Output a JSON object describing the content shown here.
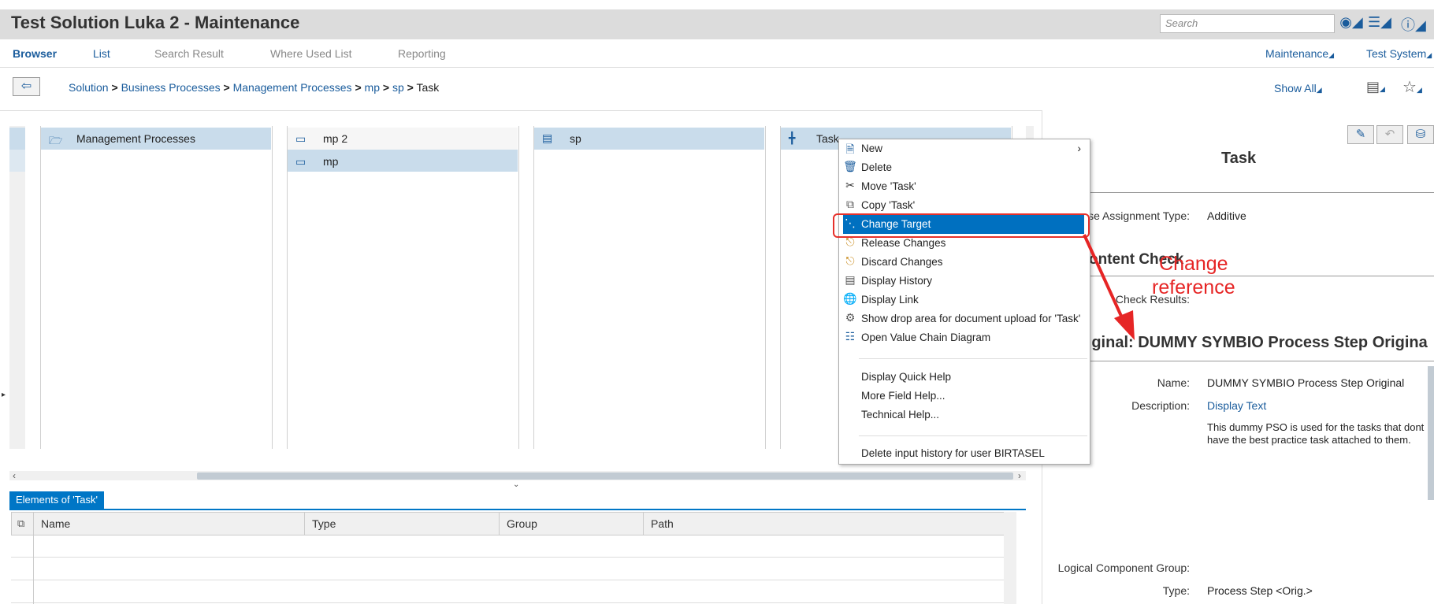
{
  "header": {
    "title": "Test Solution Luka 2 - Maintenance",
    "search_placeholder": "Search"
  },
  "nav": {
    "browser": "Browser",
    "list": "List",
    "search_result": "Search Result",
    "where_used": "Where Used List",
    "reporting": "Reporting",
    "maintenance": "Maintenance",
    "test_system": "Test System"
  },
  "breadcrumb": {
    "items": [
      "Solution",
      "Business Processes",
      "Management Processes",
      "mp",
      "sp",
      "Task"
    ],
    "sep": ">",
    "show_all": "Show All"
  },
  "panes": {
    "col1": "Management Processes",
    "col2": [
      "mp 2",
      "mp"
    ],
    "col3": "sp",
    "col4": "Task"
  },
  "context_menu": {
    "items": [
      "New",
      "Delete",
      "Move 'Task'",
      "Copy 'Task'",
      "Change Target",
      "Release Changes",
      "Discard Changes",
      "Display History",
      "Display Link",
      "Show drop area for document upload for 'Task'",
      "Open Value Chain Diagram"
    ],
    "help_items": [
      "Display Quick Help",
      "More Field Help...",
      "Technical Help..."
    ],
    "delete_history": "Delete input history for user BIRTASEL"
  },
  "annotation": {
    "line1": "Change",
    "line2": "reference"
  },
  "elements": {
    "tab": "Elements of 'Task'",
    "columns": [
      "Name",
      "Type",
      "Group",
      "Path"
    ]
  },
  "detail": {
    "title": "Task",
    "release_label": "ase Assignment Type:",
    "release_value": "Additive",
    "content_check": "ontent Check",
    "check_results": "Check Results:",
    "original_heading": "riginal: DUMMY SYMBIO Process Step Origina",
    "name_label": "Name:",
    "name_value": "DUMMY SYMBIO Process Step Original",
    "desc_label": "Description:",
    "desc_link": "Display Text",
    "desc_text_1": "This dummy PSO is used for the tasks that dont",
    "desc_text_2": "have the best practice task attached to them.",
    "lcg_label": "Logical Component Group:",
    "type_label": "Type:",
    "type_value": "Process Step <Orig.>"
  }
}
